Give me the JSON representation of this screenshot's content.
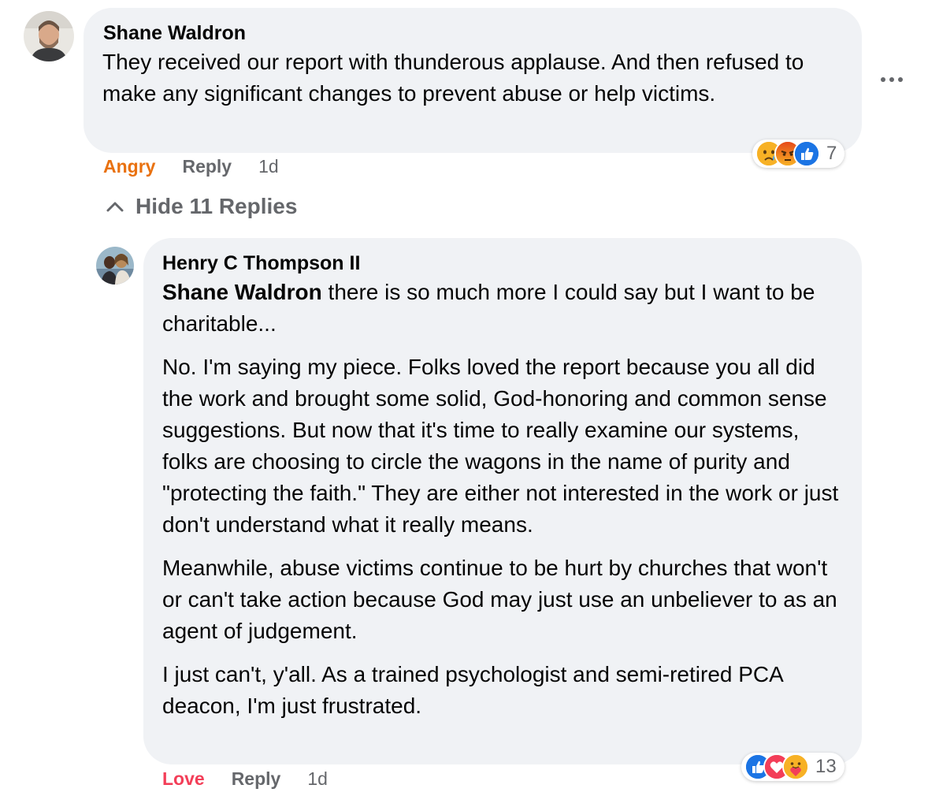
{
  "comment": {
    "author": "Shane Waldron",
    "text": "They received our report with thunderous applause. And then refused to make any significant changes to prevent abuse or help victims.",
    "reaction_label": "Angry",
    "reply_label": "Reply",
    "time": "1d",
    "reaction_icons": [
      "sad-icon",
      "angry-icon",
      "like-icon"
    ],
    "reaction_count": "7"
  },
  "replies_toggle": {
    "label": "Hide 11 Replies"
  },
  "reply": {
    "author": "Henry C Thompson II",
    "mention": "Shane Waldron",
    "para1_rest": " there is so much more I could say but I want to be charitable...",
    "para2": "No. I'm saying my piece. Folks loved the report because you all did the work and brought some solid, God-honoring and common sense suggestions. But now that it's time to really examine our systems, folks are choosing to circle the wagons in the name of purity and \"protecting the faith.\" They are either not interested in the work or just don't understand what it really means.",
    "para3": "Meanwhile, abuse victims continue to be hurt by churches that won't or can't take action because God may just use an unbeliever to as an agent of judgement.",
    "para4": "I just can't, y'all. As a trained psychologist and semi-retired PCA deacon, I'm just frustrated.",
    "reaction_label": "Love",
    "reply_label": "Reply",
    "time": "1d",
    "reaction_icons": [
      "like-icon",
      "love-icon",
      "care-icon"
    ],
    "reaction_count": "13"
  },
  "colors": {
    "bubble": "#f0f2f5",
    "angry": "#e9710f",
    "love": "#f33e58",
    "meta": "#65676b",
    "like_blue": "#1b74e4"
  }
}
